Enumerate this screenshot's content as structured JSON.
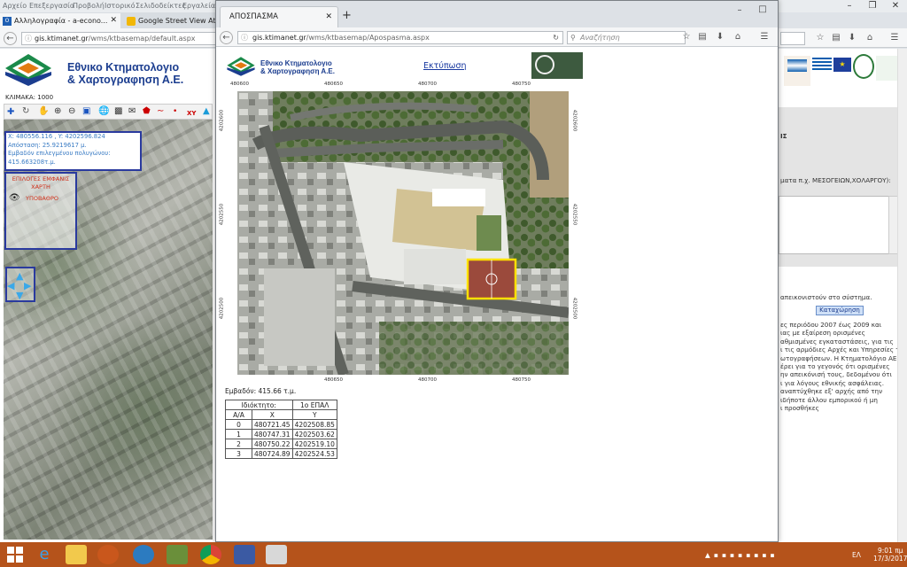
{
  "menubar": {
    "items": [
      "Αρχείο",
      "Επεξεργασία",
      "Προβολή",
      "Ιστορικό",
      "Σελιδοδείκτες",
      "Εργαλεία"
    ]
  },
  "bg_tabs": [
    {
      "label": "Αλληλογραφία - a-econo..."
    },
    {
      "label": "Google Street View Athens"
    }
  ],
  "bg_url": {
    "domain": "gis.ktimanet.gr",
    "path": "/wms/ktbasemap/default.aspx"
  },
  "left": {
    "logo_line1": "Εθνικο Κτηματολογιο",
    "logo_line2": "& Χαρτογραφηση Α.Ε.",
    "scale": "ΚΛΙΜΑΚΑ: 1000",
    "info_line1": "X: 480556.116 , Y: 4202596.824",
    "info_line2": "Απόσταση: 25.9219617 μ.",
    "info_line3": "Εμβαδόν επιλεγμένου πολυγώνου:",
    "info_line4": "415.663208τ.μ.",
    "layers_title_1": "ΕΠΙΛΟΓΕΣ ΕΜΦΑΝΙΣ",
    "layers_title_2": "ΧΑΡΤΗ",
    "layer_label": "ΥΠΟΒΑΘΡΟ",
    "xy_tool": "XY"
  },
  "popup": {
    "tab_label": "ΑΠΟΣΠΑΣΜΑ",
    "url_domain": "gis.ktimanet.gr",
    "url_path": "/wms/ktbasemap/Apospasma.aspx",
    "search_placeholder": "Αναζήτηση",
    "logo_line1": "Εθνικο Κτηματολογιο",
    "logo_line2": "& Χαρτογραφηση Α.Ε.",
    "print_link": "Εκτύπωση",
    "ticks_top": [
      "480600",
      "480650",
      "480700",
      "480750"
    ],
    "ticks_bottom": [
      "480650",
      "480700",
      "480750"
    ],
    "ticks_left": [
      "4202600",
      "4202550",
      "4202500"
    ],
    "ticks_right": [
      "4202600",
      "4202550",
      "4202500"
    ],
    "area_text": "Εμβαδόν: 415.66 τ.μ.",
    "table": {
      "owner_label": "Ιδιόκτητο:",
      "owner_value": "1ο ΕΠΑΛ",
      "headers": [
        "Α/Α",
        "X",
        "Y"
      ],
      "rows": [
        [
          "0",
          "480721.45",
          "4202508.85"
        ],
        [
          "1",
          "480747.31",
          "4202503.62"
        ],
        [
          "2",
          "480750.22",
          "4202519.10"
        ],
        [
          "3",
          "480724.89",
          "4202524.53"
        ]
      ]
    }
  },
  "right": {
    "label_es": "ΙΣ",
    "example_text": "ματα π.χ. ΜΕΣΟΓΕΙΩΝ,ΧΟΛΑΡΓΟΥ):",
    "displayed_text": "απεικονιστούν στο σύστημα.",
    "register_button": "Καταχώρηση",
    "para": [
      "ες περιόδου 2007 έως 2009 και",
      "ιας με εξαίρεση ορισμένες",
      "αθμισμένες εγκαταστάσεις, για τις",
      "ι τις αρμόδιες Αρχές και Υπηρεσίες της",
      "ωτογραφήσεων. Η Κτηματολόγιο ΑΕ",
      "έρει για το γεγονός ότι ορισμένες",
      "ην απεικόνισή τους, δεδομένου ότι",
      "ι για λόγους εθνικής ασφάλειας.",
      "αναπτύχθηκε εξ' αρχής από την",
      "ιδήποτε άλλου εμπορικού ή μη",
      "ι προσθήκες"
    ]
  },
  "taskbar": {
    "lang": "ΕΛ",
    "time": "9:01 πμ",
    "date": "17/3/2017"
  },
  "colors": {
    "taskbar": "#b5531b",
    "logo_blue": "#1b3d8f",
    "logo_orange": "#e37b12",
    "logo_green": "#1b8a4a",
    "highlight": "#ffe000"
  }
}
